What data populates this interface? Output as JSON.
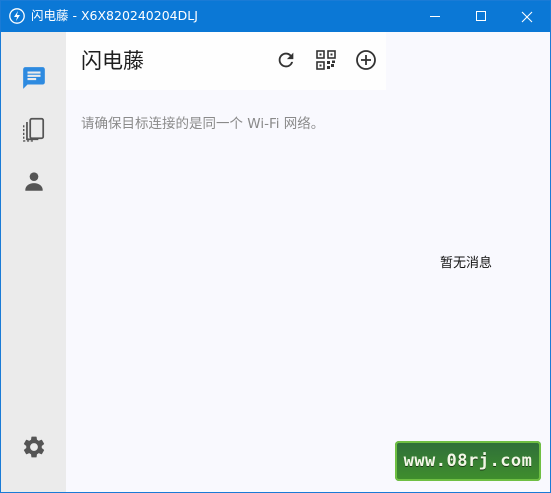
{
  "window": {
    "title": "闪电藤 - X6X820240204DLJ"
  },
  "sidebar": {
    "items": [
      {
        "icon": "chat-icon",
        "active": true
      },
      {
        "icon": "devices-icon",
        "active": false
      },
      {
        "icon": "person-icon",
        "active": false
      }
    ],
    "settings_icon": "gear-icon"
  },
  "main": {
    "title": "闪电藤",
    "hint": "请确保目标连接的是同一个 Wi-Fi 网络。",
    "empty_message": "暂无消息"
  },
  "watermark": {
    "text": "www.08rj.com"
  },
  "colors": {
    "titlebar": "#0b78d6",
    "accent": "#2d8ae0",
    "sidebar": "#ebebeb",
    "icon_gray": "#555555"
  }
}
